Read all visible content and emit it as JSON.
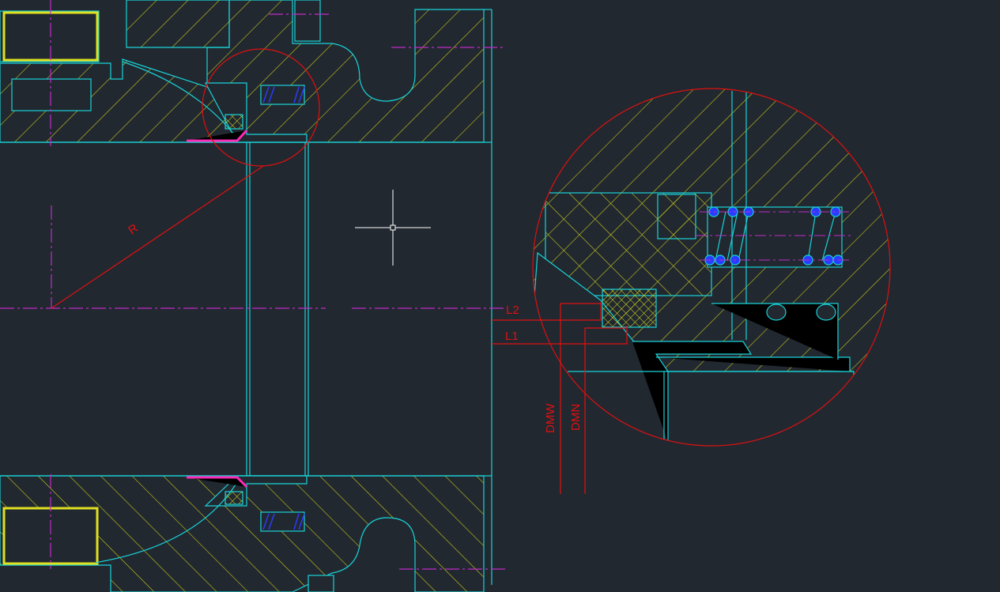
{
  "drawing": {
    "labels": {
      "radius": "R",
      "l2": "L2",
      "l1": "L1",
      "dmw": "DMW",
      "dmn": "DMN"
    }
  },
  "colors": {
    "background": "#212830",
    "outline": "#19d3d8",
    "hatch": "#d8d820",
    "centerline": "#c02cc8",
    "dimension": "#e01010",
    "highlight": "#ff2ab4",
    "spring": "#2a3cff"
  }
}
